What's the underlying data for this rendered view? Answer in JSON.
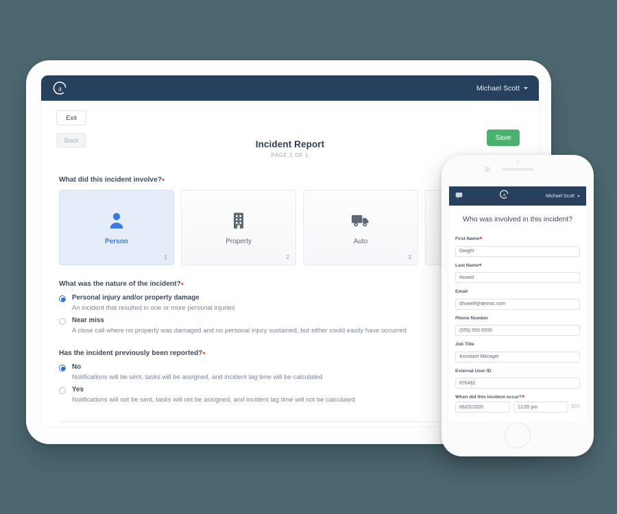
{
  "theme": {
    "background": "#4d6871",
    "navy": "#27405e",
    "accent_blue": "#3b7ddd",
    "save_green": "#4cb070",
    "required_red": "#e8604c"
  },
  "tablet": {
    "nav": {
      "logo_icon": "brand-a-logo",
      "user_name": "Michael Scott",
      "caret_icon": "chevron-down-icon"
    },
    "toolbar": {
      "exit_label": "Exit",
      "back_label": "Back",
      "save_label": "Save"
    },
    "header": {
      "title": "Incident Report",
      "subtitle": "PAGE 1 OF 1"
    },
    "question_involve": {
      "label": "What did this incident involve?",
      "required": true,
      "cards": [
        {
          "label": "Person",
          "number": "1",
          "icon": "person-icon",
          "selected": true
        },
        {
          "label": "Property",
          "number": "2",
          "icon": "building-icon",
          "selected": false
        },
        {
          "label": "Auto",
          "number": "3",
          "icon": "truck-icon",
          "selected": false
        }
      ]
    },
    "question_nature": {
      "label": "What was the nature of the incident?",
      "required": true,
      "options": [
        {
          "title": "Personal injury and/or property damage",
          "description": "An incident that resulted in one or more personal injuries",
          "selected": true
        },
        {
          "title": "Near miss",
          "description": "A close call where no property was damaged and no personal injury sustained, but either could easily have occurred",
          "selected": false
        }
      ]
    },
    "question_reported": {
      "label": "Has the incident previously been reported?",
      "required": true,
      "options": [
        {
          "title": "No",
          "description": "Notifications will be sent, tasks will be assigned, and incident lag time will be calculated",
          "selected": true
        },
        {
          "title": "Yes",
          "description": "Notifications will not be sent, tasks will not be assigned, and incident lag time will not be calculated",
          "selected": false
        }
      ]
    }
  },
  "phone": {
    "nav": {
      "chat_icon": "chat-bubble-icon",
      "logo_icon": "brand-a-logo",
      "user_name": "Michael Scott",
      "caret_icon": "chevron-down-icon"
    },
    "heading": "Who was involved in this incident?",
    "fields": [
      {
        "label": "First Name",
        "value": "Dwight",
        "required": true,
        "name": "first-name-field"
      },
      {
        "label": "Last Name",
        "value": "Howell",
        "required": true,
        "name": "last-name-field"
      },
      {
        "label": "Email",
        "value": "dhowell@democ.com",
        "required": false,
        "name": "email-field"
      },
      {
        "label": "Phone Number",
        "value": "(555) 555-5555",
        "required": false,
        "name": "phone-number-field"
      },
      {
        "label": "Job Title",
        "value": "Assistant Manager",
        "required": false,
        "name": "job-title-field"
      },
      {
        "label": "External User ID",
        "value": "876492",
        "required": false,
        "name": "external-user-id-field"
      }
    ],
    "occurred": {
      "label": "When did this incident occur?",
      "required": true,
      "date": "06/02/2020",
      "time": "12:05 pm",
      "timezone": "EDT"
    }
  }
}
